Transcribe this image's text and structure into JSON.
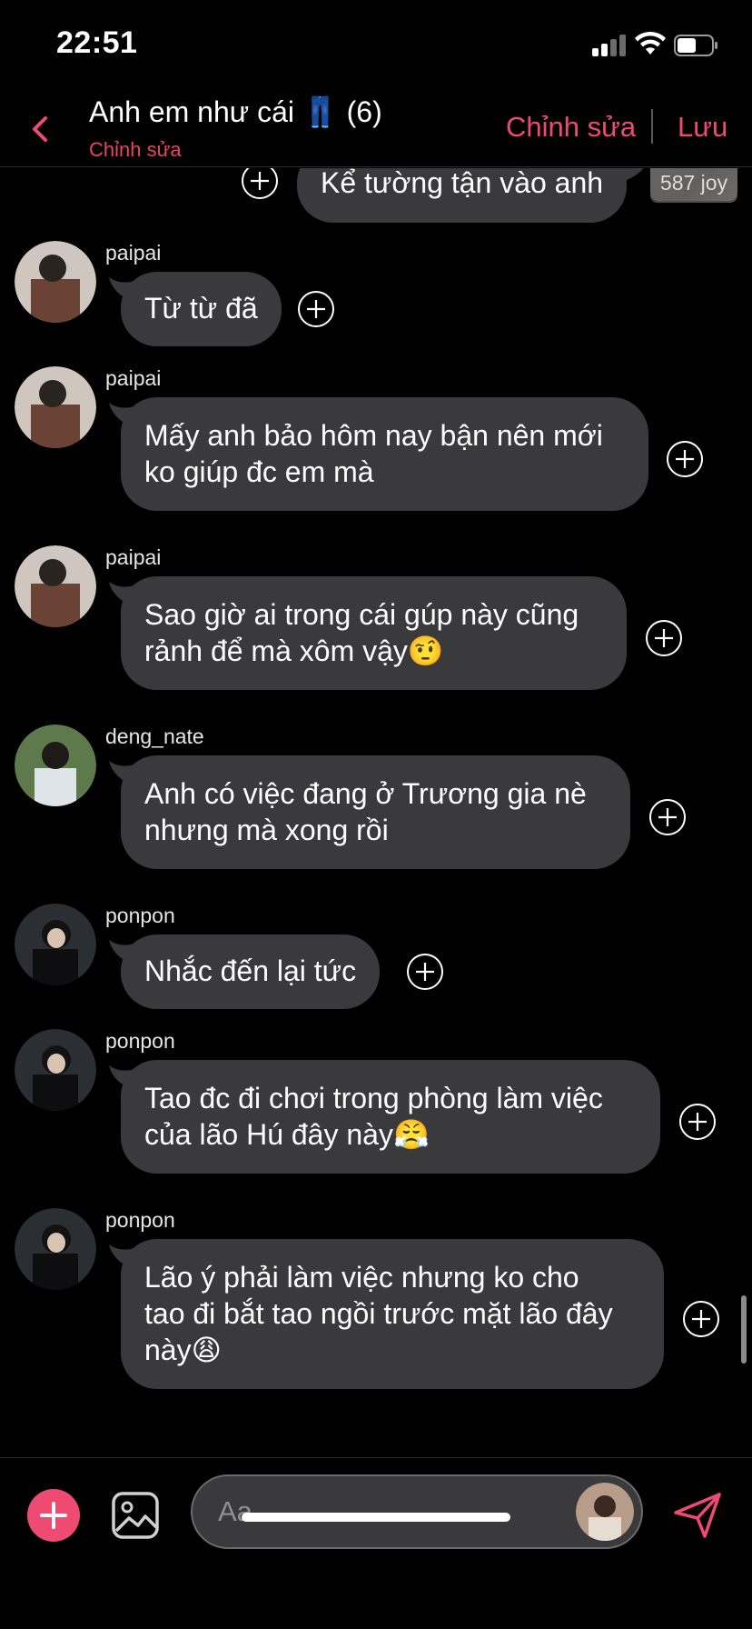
{
  "status_bar": {
    "time": "22:51"
  },
  "header": {
    "title": "Anh em như cái 👖 (6)",
    "subtitle": "Chỉnh sửa",
    "edit_label": "Chỉnh sửa",
    "save_label": "Lưu"
  },
  "top_message": {
    "text": "Kể tường tận vào anh",
    "badge": "587 joy"
  },
  "messages": [
    {
      "sender": "paipai",
      "text": "Từ từ đã"
    },
    {
      "sender": "paipai",
      "text": "Mấy anh bảo hôm nay bận nên mới\nko giúp đc em mà"
    },
    {
      "sender": "paipai",
      "text": "Sao giờ ai trong cái gúp này cũng\nrảnh để mà xôm vậy🤨"
    },
    {
      "sender": "deng_nate",
      "text": "Anh có việc đang ở Trương gia nè\nnhưng mà xong rồi"
    },
    {
      "sender": "ponpon",
      "text": "Nhắc đến lại tức"
    },
    {
      "sender": "ponpon",
      "text": "Tao đc đi chơi trong phòng làm việc\ncủa lão Hú đây này😤"
    },
    {
      "sender": "ponpon",
      "text": "Lão ý phải làm việc nhưng ko cho\ntao đi bắt tao ngồi trước mặt lão đây\nnày😩"
    }
  ],
  "composer": {
    "placeholder": "Aa"
  },
  "colors": {
    "accent": "#ef4b72",
    "bubble": "#3a3a3c",
    "background": "#000000"
  },
  "icons": [
    "back-chevron-icon",
    "add-reaction-icon",
    "plus-icon",
    "image-icon",
    "send-icon"
  ]
}
